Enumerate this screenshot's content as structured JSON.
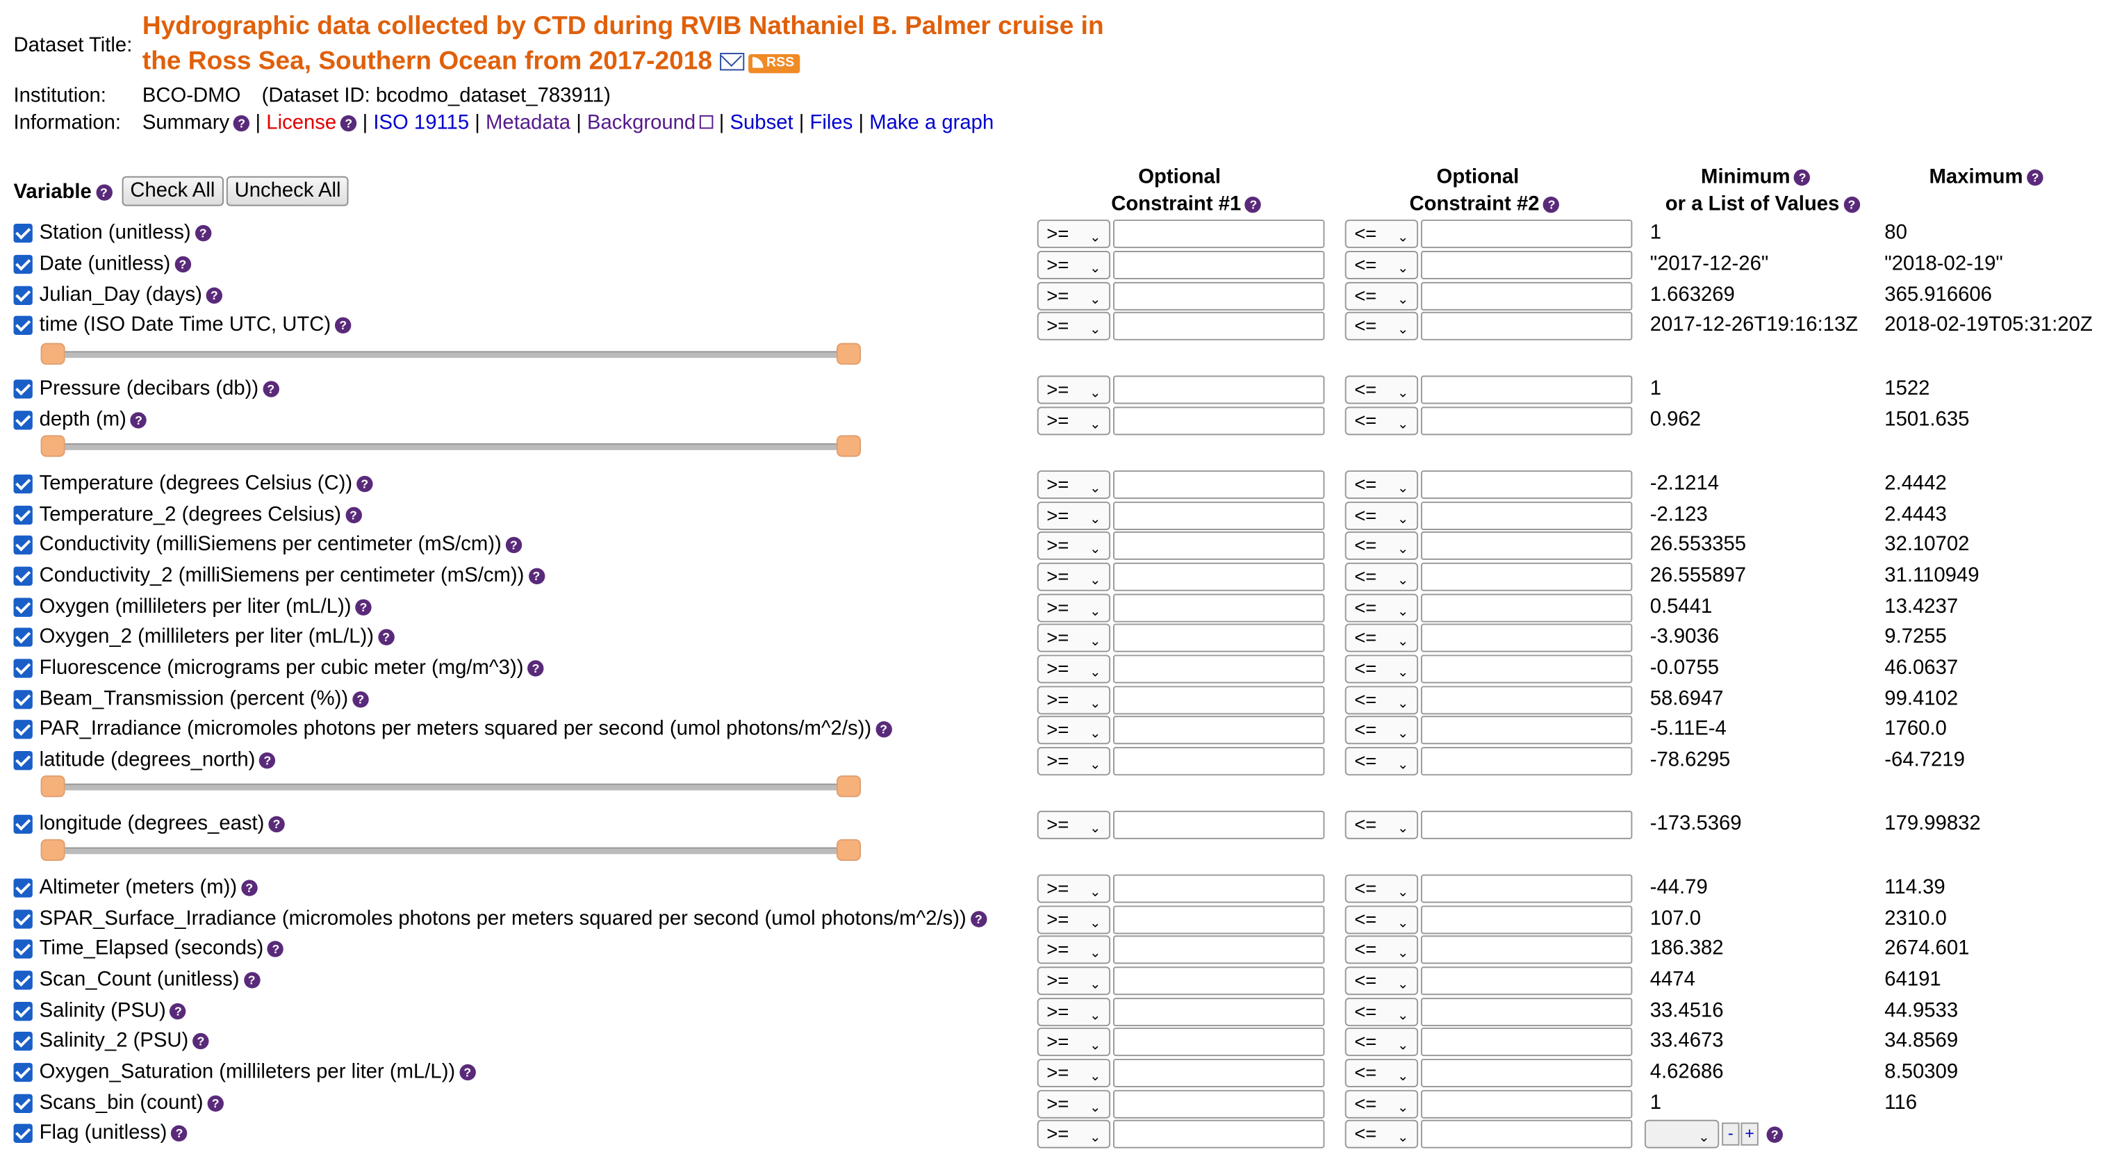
{
  "header": {
    "dataset_title_label": "Dataset Title:",
    "title_line1": "Hydrographic data collected by CTD during RVIB Nathaniel B. Palmer cruise in",
    "title_line2": "the Ross Sea, Southern Ocean from 2017-2018",
    "rss_label": "RSS",
    "institution_label": "Institution:",
    "institution_value": "BCO-DMO",
    "dataset_id": "(Dataset ID: bcodmo_dataset_783911)",
    "information_label": "Information:",
    "links": {
      "summary": "Summary",
      "license": "License",
      "iso": "ISO 19115",
      "metadata": "Metadata",
      "background": "Background",
      "subset": "Subset",
      "files": "Files",
      "graph": "Make a graph"
    },
    "sep": "|"
  },
  "table_header": {
    "variable": "Variable",
    "check_all": "Check All",
    "uncheck_all": "Uncheck All",
    "c1_line1": "Optional",
    "c1_line2": "Constraint #1",
    "c2_line1": "Optional",
    "c2_line2": "Constraint #2",
    "min_line1": "Minimum",
    "min_line2": "or a List of Values",
    "max": "Maximum"
  },
  "op1": ">=",
  "op2": "<=",
  "help_glyph": "?",
  "variables": [
    {
      "name": "Station (unitless)",
      "min": "1",
      "max": "80"
    },
    {
      "name": "Date (unitless)",
      "min": "\"2017-12-26\"",
      "max": "\"2018-02-19\""
    },
    {
      "name": "Julian_Day (days)",
      "min": "1.663269",
      "max": "365.916606"
    },
    {
      "name": "time (ISO Date Time UTC, UTC)",
      "min": "2017-12-26T19:16:13Z",
      "max": "2018-02-19T05:31:20Z"
    },
    {
      "name": "Pressure (decibars (db))",
      "min": "1",
      "max": "1522"
    },
    {
      "name": "depth (m)",
      "min": "0.962",
      "max": "1501.635"
    },
    {
      "name": "Temperature (degrees Celsius (C))",
      "min": "-2.1214",
      "max": "2.4442"
    },
    {
      "name": "Temperature_2 (degrees Celsius)",
      "min": "-2.123",
      "max": "2.4443"
    },
    {
      "name": "Conductivity (milliSiemens per centimeter (mS/cm))",
      "min": "26.553355",
      "max": "32.10702"
    },
    {
      "name": "Conductivity_2 (milliSiemens per centimeter (mS/cm))",
      "min": "26.555897",
      "max": "31.110949"
    },
    {
      "name": "Oxygen (millileters per liter (mL/L))",
      "min": "0.5441",
      "max": "13.4237"
    },
    {
      "name": "Oxygen_2 (millileters per liter (mL/L))",
      "min": "-3.9036",
      "max": "9.7255"
    },
    {
      "name": "Fluorescence (micrograms per cubic meter (mg/m^3))",
      "min": "-0.0755",
      "max": "46.0637"
    },
    {
      "name": "Beam_Transmission (percent (%))",
      "min": "58.6947",
      "max": "99.4102"
    },
    {
      "name": "PAR_Irradiance (micromoles photons per meters squared per second (umol photons/m^2/s))",
      "min": "-5.11E-4",
      "max": "1760.0"
    },
    {
      "name": "latitude (degrees_north)",
      "min": "-78.6295",
      "max": "-64.7219"
    },
    {
      "name": "longitude (degrees_east)",
      "min": "-173.5369",
      "max": "179.99832"
    },
    {
      "name": "Altimeter (meters (m))",
      "min": "-44.79",
      "max": "114.39"
    },
    {
      "name": "SPAR_Surface_Irradiance (micromoles photons per meters squared per second (umol photons/m^2/s))",
      "min": "107.0",
      "max": "2310.0"
    },
    {
      "name": "Time_Elapsed (seconds)",
      "min": "186.382",
      "max": "2674.601"
    },
    {
      "name": "Scan_Count (unitless)",
      "min": "4474",
      "max": "64191"
    },
    {
      "name": "Salinity (PSU)",
      "min": "33.4516",
      "max": "44.9533"
    },
    {
      "name": "Salinity_2 (PSU)",
      "min": "33.4673",
      "max": "34.8569"
    },
    {
      "name": "Oxygen_Saturation (millileters per liter (mL/L))",
      "min": "4.62686",
      "max": "8.50309"
    },
    {
      "name": "Scans_bin (count)",
      "min": "1",
      "max": "116"
    },
    {
      "name": "Flag (unitless)",
      "min": "",
      "max": ""
    }
  ],
  "flag_controls": {
    "minus": "-",
    "plus": "+"
  }
}
